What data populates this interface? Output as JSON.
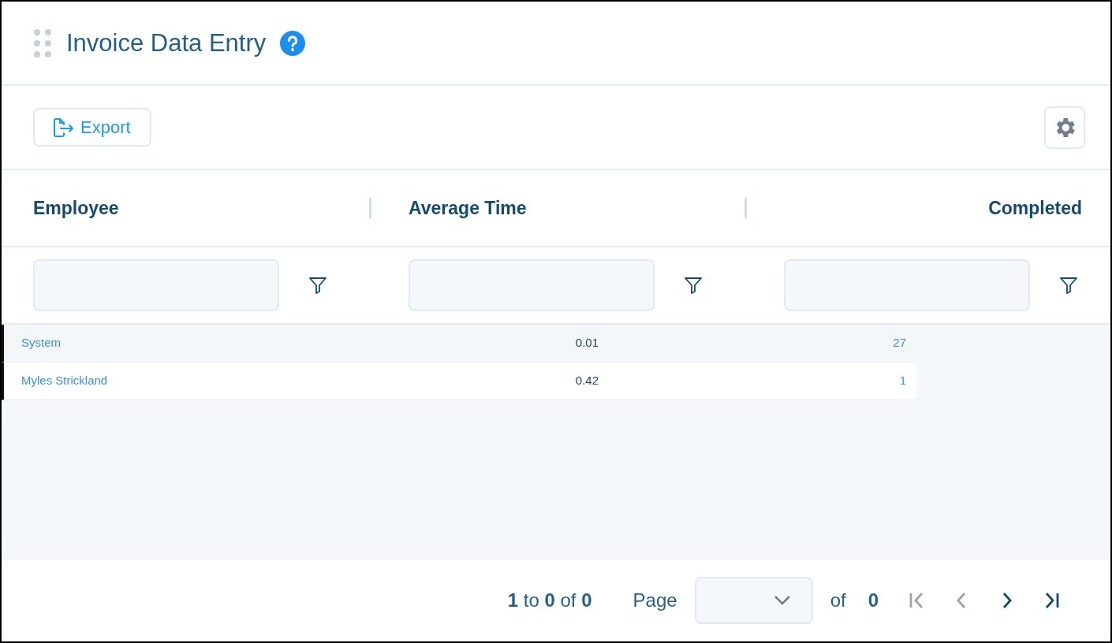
{
  "panel": {
    "title": "Invoice Data Entry"
  },
  "toolbar": {
    "export_label": "Export"
  },
  "table": {
    "columns": [
      {
        "label": "Employee"
      },
      {
        "label": "Average Time"
      },
      {
        "label": "Completed"
      }
    ],
    "rows": [
      {
        "employee": "System",
        "average_time": "0.01",
        "completed": "27"
      },
      {
        "employee": "Myles Strickland",
        "average_time": "0.42",
        "completed": "1"
      }
    ]
  },
  "pagination": {
    "summary": "**1** to **0** of **0**",
    "page_label": "Page",
    "of_label": "of",
    "total_pages": "0",
    "buttons": [
      {
        "kind": "first",
        "disabled": true
      },
      {
        "kind": "prev",
        "disabled": true
      },
      {
        "kind": "next",
        "disabled": false
      },
      {
        "kind": "last",
        "disabled": false
      }
    ]
  }
}
